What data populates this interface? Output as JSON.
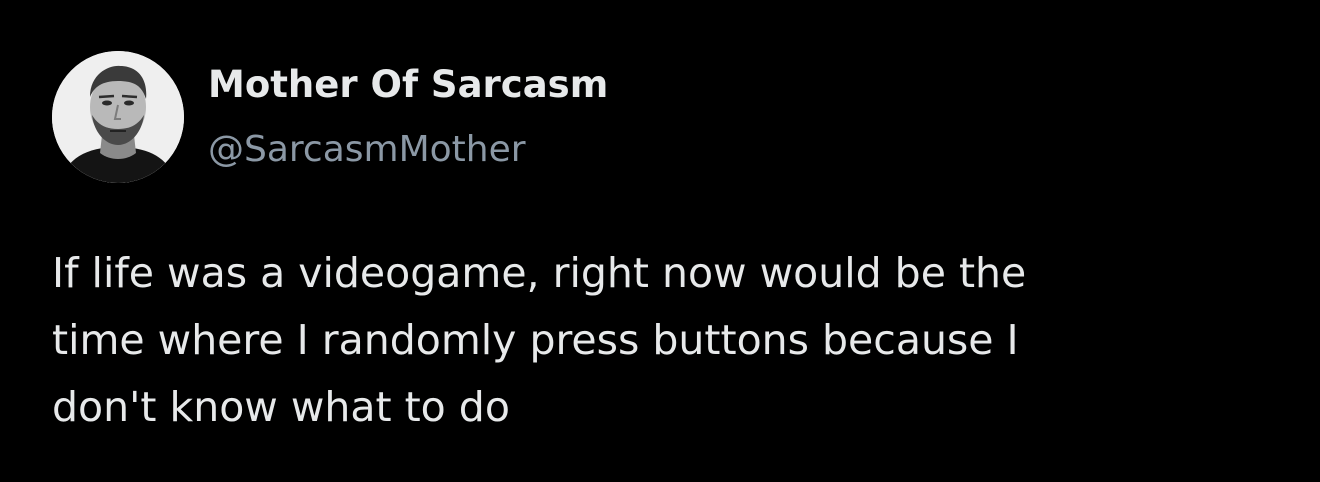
{
  "author": {
    "display_name": "Mother Of Sarcasm",
    "handle": "@SarcasmMother",
    "avatar_icon": "user-avatar-photo"
  },
  "tweet": {
    "lines": [
      "If life was a videogame, right now would be the",
      "time where I randomly press buttons because I",
      "don't know what to do"
    ]
  },
  "colors": {
    "background": "#000000",
    "primary_text": "#e7e9ea",
    "secondary_text": "#8b98a5"
  }
}
